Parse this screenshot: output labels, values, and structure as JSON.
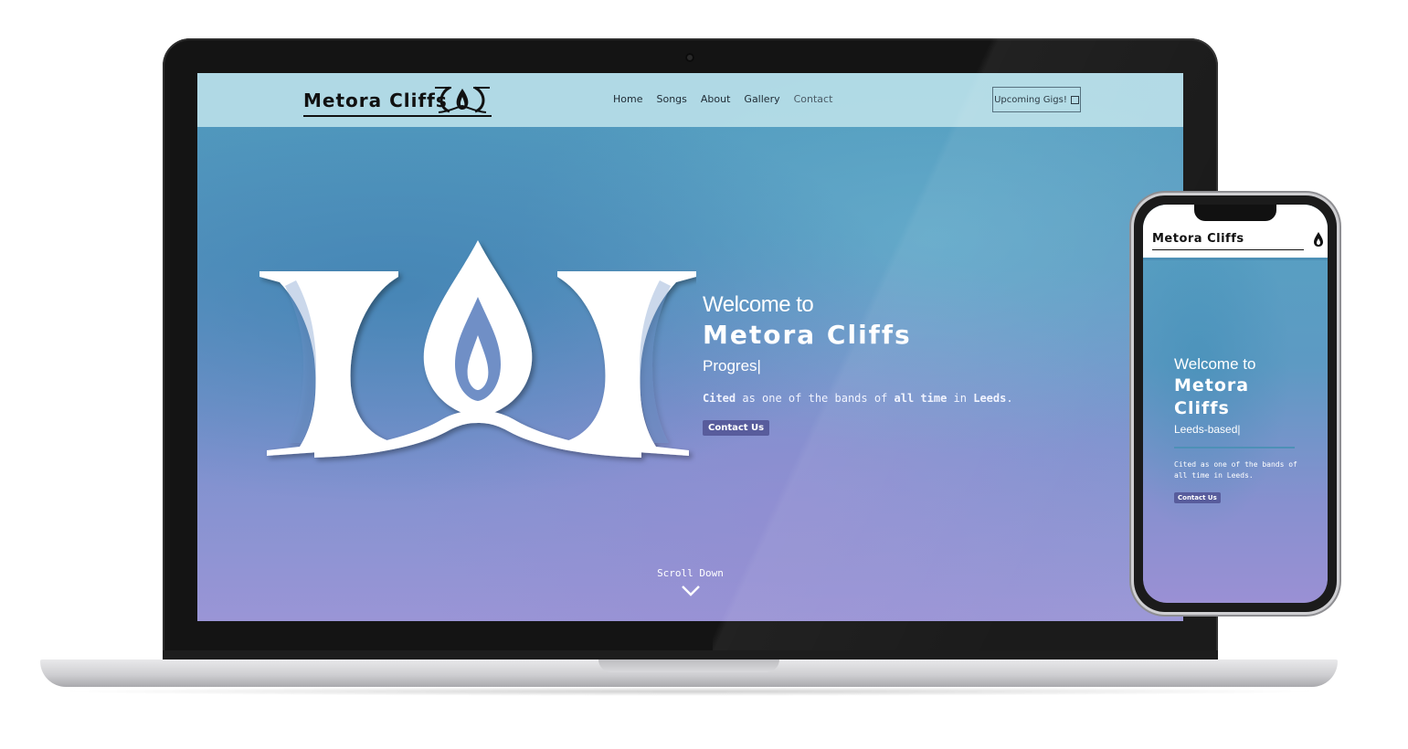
{
  "laptop": {
    "brand": "Metora Cliffs",
    "nav": [
      "Home",
      "Songs",
      "About",
      "Gallery",
      "Contact"
    ],
    "gigs_button": "Upcoming Gigs!",
    "hero": {
      "welcome": "Welcome to",
      "band_name": "Metora Cliffs",
      "genre": "Progres|",
      "cited_parts": [
        "Cited",
        " as one of the bands of ",
        "all time",
        " in ",
        "Leeds",
        "."
      ],
      "contact_button": "Contact Us"
    },
    "scroll_text": "Scroll Down"
  },
  "phone": {
    "brand": "Metora Cliffs",
    "hero": {
      "welcome": "Welcome to",
      "band_name_line1": "Metora",
      "band_name_line2": "Cliffs",
      "genre": "Leeds-based|",
      "cited": "Cited as one of the bands of all time in Leeds.",
      "contact_button": "Contact Us"
    }
  },
  "colors": {
    "nav_bg": "#b9dee8",
    "accent_button": "#585c9c",
    "gradient_top": "#4f9bbd",
    "gradient_bottom": "#9a95d6"
  },
  "icons": {
    "brand_emblem": "cliffs-flame-emblem-icon",
    "gigs": "external-box-icon",
    "scroll": "chevron-down-icon",
    "phone_menu": "flame-icon"
  }
}
